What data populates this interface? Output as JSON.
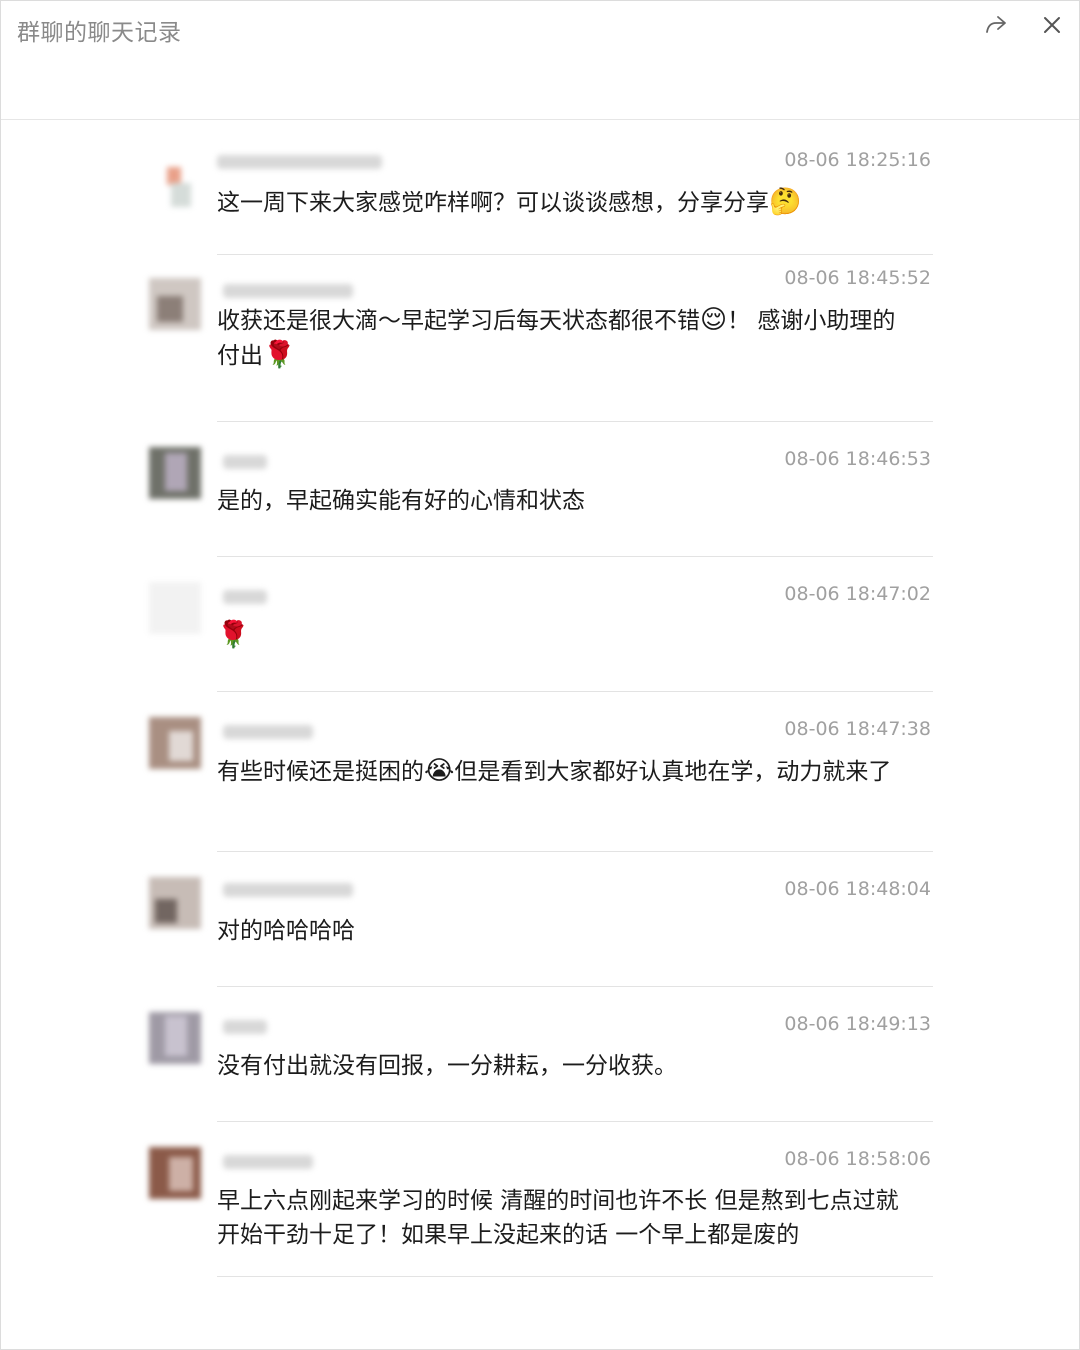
{
  "window": {
    "title": "群聊的聊天记录"
  },
  "icons": {
    "share": "share-arrow-icon",
    "close": "close-icon"
  },
  "messages": [
    {
      "time": "08-06 18:25:16",
      "text": "这一周下来大家感觉咋样啊？可以谈谈感想，分享分享",
      "emoji": "🤔"
    },
    {
      "time": "08-06 18:45:52",
      "text": "收获还是很大滴～早起学习后每天状态都很不错",
      "emoji": "😌",
      "text2": "！ 感谢小助理的付出",
      "emoji2": "🌹"
    },
    {
      "time": "08-06 18:46:53",
      "text": "是的，早起确实能有好的心情和状态"
    },
    {
      "time": "08-06 18:47:02",
      "text": "",
      "emoji": "🌹"
    },
    {
      "time": "08-06 18:47:38",
      "text": "有些时候还是挺困的",
      "emoji": "😭",
      "text2": "但是看到大家都好认真地在学，动力就来了"
    },
    {
      "time": "08-06 18:48:04",
      "text": "对的哈哈哈哈"
    },
    {
      "time": "08-06 18:49:13",
      "text": "没有付出就没有回报，一分耕耘，一分收获。"
    },
    {
      "time": "08-06 18:58:06",
      "text": "早上六点刚起来学习的时候 清醒的时间也许不长 但是熬到七点过就开始干劲十足了！如果早上没起来的话 一个早上都是废的"
    }
  ]
}
